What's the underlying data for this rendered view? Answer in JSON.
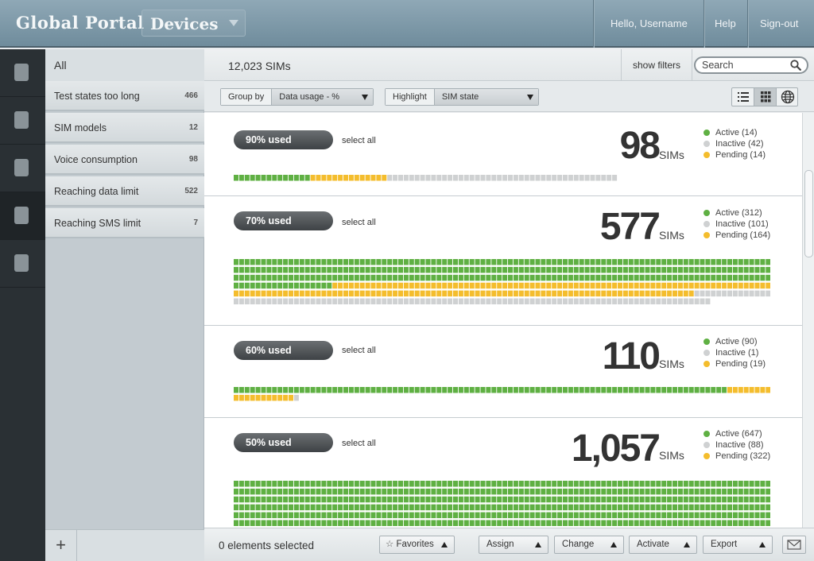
{
  "header": {
    "brand": "Global Portal",
    "context": "Devices",
    "greeting": "Hello, Username",
    "help": "Help",
    "signout": "Sign-out"
  },
  "rail": {
    "icons": [
      "nav-icon-1",
      "nav-icon-2",
      "nav-icon-3",
      "nav-icon-4",
      "nav-icon-5"
    ]
  },
  "sidebar": {
    "all_label": "All",
    "items": [
      {
        "label": "Test states too long",
        "count": "466"
      },
      {
        "label": "SIM models",
        "count": "12"
      },
      {
        "label": "Voice consumption",
        "count": "98"
      },
      {
        "label": "Reaching data limit",
        "count": "522"
      },
      {
        "label": "Reaching SMS limit",
        "count": "7"
      }
    ],
    "add_label": "+"
  },
  "topbar": {
    "count_label": "12,023 SIMs",
    "show_filters": "show filters",
    "search_placeholder": "Search"
  },
  "toolbar": {
    "group_by_label": "Group by",
    "group_by_value": "Data usage - %",
    "highlight_label": "Highlight",
    "highlight_value": "SIM state"
  },
  "colors": {
    "active": "#5fb043",
    "inactive": "#cfd1d2",
    "pending": "#f4bd2d"
  },
  "sections": [
    {
      "pill": "90% used",
      "select_all": "select all",
      "total": "98",
      "unit": "SIMs",
      "active": 14,
      "inactive": 42,
      "pending": 14,
      "legend": [
        "Active (14)",
        "Inactive (42)",
        "Pending (14)"
      ]
    },
    {
      "pill": "70% used",
      "select_all": "select all",
      "total": "577",
      "unit": "SIMs",
      "active": 312,
      "inactive": 101,
      "pending": 164,
      "legend": [
        "Active (312)",
        "Inactive (101)",
        "Pending (164)"
      ]
    },
    {
      "pill": "60% used",
      "select_all": "select all",
      "total": "110",
      "unit": "SIMs",
      "active": 90,
      "inactive": 1,
      "pending": 19,
      "legend": [
        "Active (90)",
        "Inactive (1)",
        "Pending (19)"
      ]
    },
    {
      "pill": "50% used",
      "select_all": "select all",
      "total": "1,057",
      "unit": "SIMs",
      "active": 647,
      "inactive": 88,
      "pending": 322,
      "legend": [
        "Active (647)",
        "Inactive (88)",
        "Pending (322)"
      ]
    }
  ],
  "bottombar": {
    "selected": "0 elements selected",
    "favorites": "Favorites",
    "assign": "Assign",
    "change": "Change",
    "activate": "Activate",
    "export": "Export"
  }
}
